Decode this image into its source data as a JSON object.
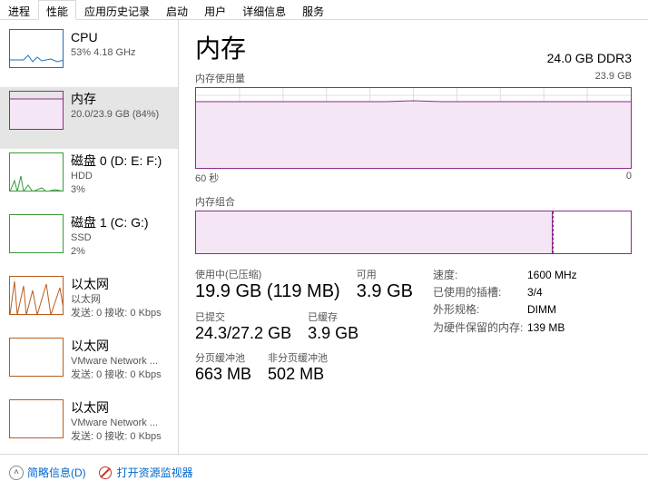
{
  "tabs": [
    "进程",
    "性能",
    "应用历史记录",
    "启动",
    "用户",
    "详细信息",
    "服务"
  ],
  "active_tab_index": 1,
  "sidebar": [
    {
      "title": "CPU",
      "sub": "53% 4.18 GHz",
      "color": "#1f6fb2",
      "thumb": "cpu"
    },
    {
      "title": "内存",
      "sub": "20.0/23.9 GB (84%)",
      "color": "#8b2c8b",
      "thumb": "mem",
      "selected": true
    },
    {
      "title": "磁盘 0 (D: E: F:)",
      "sub1": "HDD",
      "sub2": "3%",
      "color": "#3a9a3a",
      "thumb": "disk"
    },
    {
      "title": "磁盘 1 (C: G:)",
      "sub1": "SSD",
      "sub2": "2%",
      "color": "#3a9a3a",
      "thumb": "disk2"
    },
    {
      "title": "以太网",
      "sub1": "以太网",
      "sub2": "发送: 0 接收: 0 Kbps",
      "color": "#b85c1e",
      "thumb": "eth"
    },
    {
      "title": "以太网",
      "sub1": "VMware Network ...",
      "sub2": "发送: 0 接收: 0 Kbps",
      "color": "#b85c1e",
      "thumb": "blank"
    },
    {
      "title": "以太网",
      "sub1": "VMware Network ...",
      "sub2": "发送: 0 接收: 0 Kbps",
      "color": "#b85c1e",
      "thumb": "blank"
    }
  ],
  "main": {
    "title": "内存",
    "capacity": "24.0 GB DDR3",
    "usage_label": "内存使用量",
    "usage_max": "23.9 GB",
    "x_left": "60 秒",
    "x_right": "0",
    "compo_label": "内存组合",
    "stats": {
      "inuse_label": "使用中(已压缩)",
      "inuse_value": "19.9 GB (119 MB)",
      "avail_label": "可用",
      "avail_value": "3.9 GB",
      "commit_label": "已提交",
      "commit_value": "24.3/27.2 GB",
      "cached_label": "已缓存",
      "cached_value": "3.9 GB",
      "paged_label": "分页缓冲池",
      "paged_value": "663 MB",
      "nonpaged_label": "非分页缓冲池",
      "nonpaged_value": "502 MB"
    },
    "right": {
      "speed_k": "速度:",
      "speed_v": "1600 MHz",
      "slots_k": "已使用的插槽:",
      "slots_v": "3/4",
      "form_k": "外形规格:",
      "form_v": "DIMM",
      "reserved_k": "为硬件保留的内存:",
      "reserved_v": "139 MB"
    }
  },
  "footer": {
    "brief": "简略信息(D)",
    "resmon": "打开资源监视器"
  },
  "chart_data": {
    "type": "line",
    "title": "内存使用量",
    "xlabel": "60 秒 → 0",
    "ylabel": "GB",
    "ylim": [
      0,
      23.9
    ],
    "x_seconds": [
      60,
      50,
      40,
      30,
      20,
      10,
      0
    ],
    "values": [
      20.0,
      20.0,
      20.0,
      20.1,
      20.0,
      20.0,
      19.9
    ],
    "composition": {
      "type": "bar",
      "total_gb": 23.9,
      "segments": [
        {
          "name": "使用中",
          "gb": 19.9
        },
        {
          "name": "已缓存/可用",
          "gb": 4.0
        }
      ]
    }
  }
}
